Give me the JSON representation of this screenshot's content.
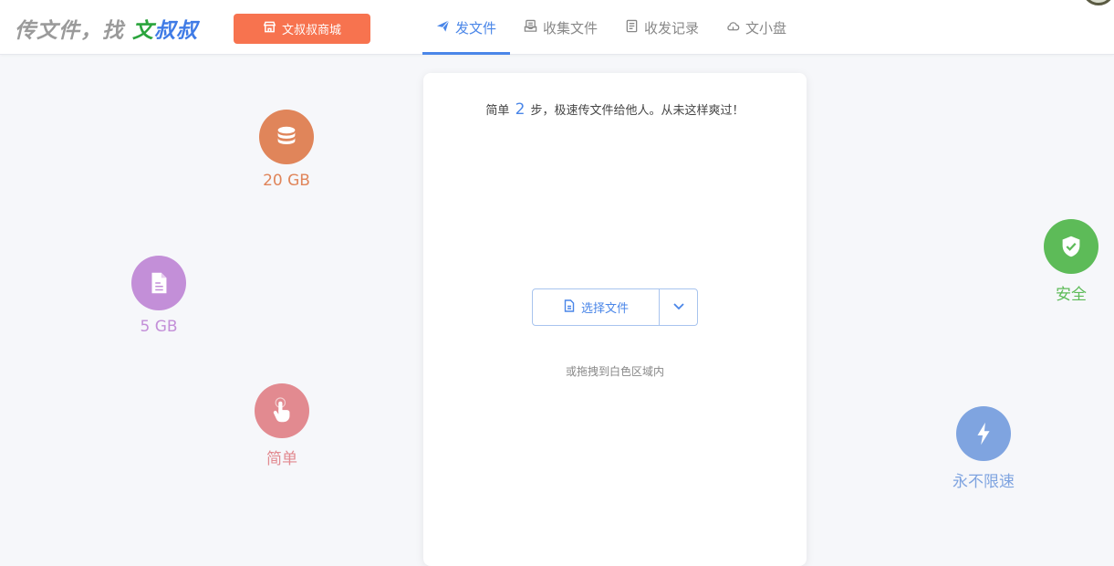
{
  "header": {
    "logo": {
      "prefix": "传文件，找 ",
      "green": "文",
      "blue": "叔叔"
    },
    "shop_button": {
      "label": "文叔叔商城",
      "icon": "store-icon"
    },
    "tabs": [
      {
        "label": "发文件",
        "icon": "paper-plane-icon",
        "active": true
      },
      {
        "label": "收集文件",
        "icon": "inbox-icon",
        "active": false
      },
      {
        "label": "收发记录",
        "icon": "document-list-icon",
        "active": false
      },
      {
        "label": "文小盘",
        "icon": "cloud-drive-icon",
        "active": false
      }
    ]
  },
  "upload_card": {
    "tagline_before": "简单",
    "tagline_number": "2",
    "tagline_after": "步，极速传文件给他人。从未这样爽过！",
    "select_button": {
      "label": "选择文件",
      "icon": "file-icon"
    },
    "dropdown": {
      "icon": "chevron-down-icon"
    },
    "drop_hint": "或拖拽到白色区域内"
  },
  "features": [
    {
      "key": "storage",
      "label": "20 GB",
      "icon": "database-icon",
      "color": "#e0855a"
    },
    {
      "key": "file-size",
      "label": "5 GB",
      "icon": "file-icon",
      "color": "#c38fd8"
    },
    {
      "key": "simple",
      "label": "简单",
      "icon": "hand-pointer-icon",
      "color": "#e28a90"
    },
    {
      "key": "safe",
      "label": "安全",
      "icon": "shield-check-icon",
      "color": "#5dbb58"
    },
    {
      "key": "speed",
      "label": "永不限速",
      "icon": "lightning-icon",
      "color": "#7fa4e0"
    }
  ],
  "colors": {
    "accent": "#4a86e8",
    "shop": "#f7734f",
    "background": "#f6f7fa"
  }
}
